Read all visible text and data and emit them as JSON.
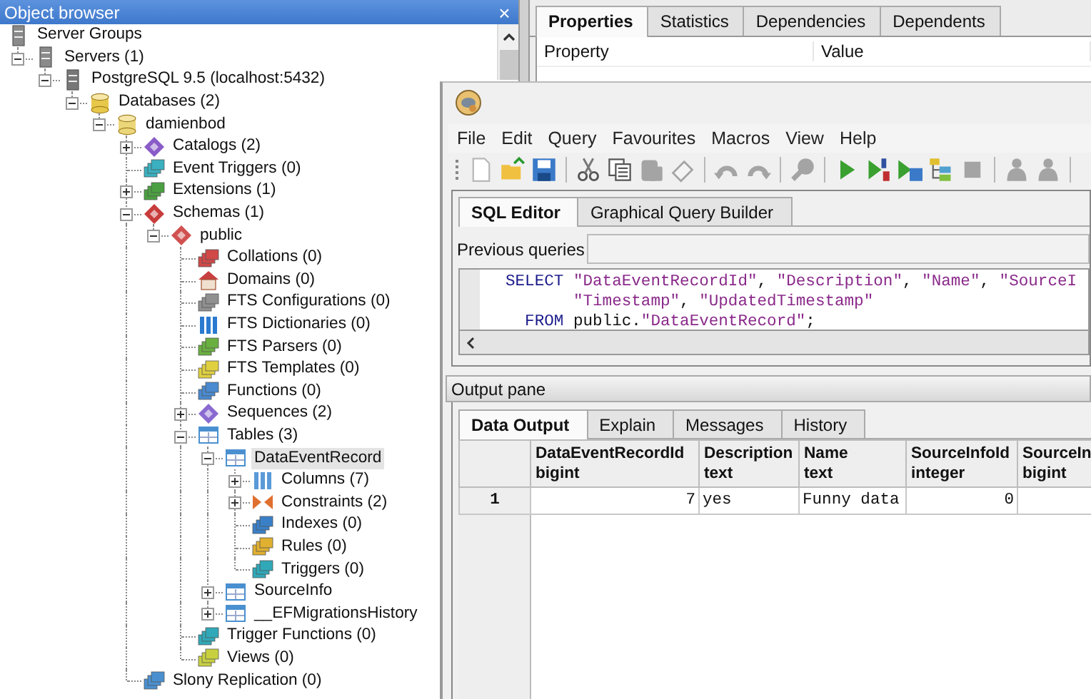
{
  "object_browser": {
    "title": "Object browser",
    "close": "×",
    "tree": [
      {
        "label": "Server Groups",
        "kind": "server_groups",
        "selected": false,
        "children": [
          {
            "label": "Servers (1)",
            "kind": "servers",
            "expanded": true,
            "selected": false,
            "children": [
              {
                "label": "PostgreSQL 9.5 (localhost:5432)",
                "kind": "server",
                "expanded": true,
                "selected": false,
                "children": [
                  {
                    "label": "Databases (2)",
                    "kind": "databases",
                    "expanded": true,
                    "selected": false,
                    "children": [
                      {
                        "label": "damienbod",
                        "kind": "database",
                        "expanded": true,
                        "selected": false,
                        "children": [
                          {
                            "label": "Catalogs (2)",
                            "kind": "catalogs",
                            "expanded": false,
                            "selected": false
                          },
                          {
                            "label": "Event Triggers (0)",
                            "kind": "event_triggers",
                            "selected": false
                          },
                          {
                            "label": "Extensions (1)",
                            "kind": "extensions",
                            "expanded": false,
                            "selected": false
                          },
                          {
                            "label": "Schemas (1)",
                            "kind": "schemas",
                            "expanded": true,
                            "selected": false,
                            "children": [
                              {
                                "label": "public",
                                "kind": "schema",
                                "expanded": true,
                                "selected": false,
                                "children": [
                                  {
                                    "label": "Collations (0)",
                                    "kind": "collations",
                                    "selected": false
                                  },
                                  {
                                    "label": "Domains (0)",
                                    "kind": "domains",
                                    "selected": false
                                  },
                                  {
                                    "label": "FTS Configurations (0)",
                                    "kind": "fts_configurations",
                                    "selected": false
                                  },
                                  {
                                    "label": "FTS Dictionaries (0)",
                                    "kind": "fts_dictionaries",
                                    "selected": false
                                  },
                                  {
                                    "label": "FTS Parsers (0)",
                                    "kind": "fts_parsers",
                                    "selected": false
                                  },
                                  {
                                    "label": "FTS Templates (0)",
                                    "kind": "fts_templates",
                                    "selected": false
                                  },
                                  {
                                    "label": "Functions (0)",
                                    "kind": "functions",
                                    "selected": false
                                  },
                                  {
                                    "label": "Sequences (2)",
                                    "kind": "sequences",
                                    "expanded": false,
                                    "selected": false
                                  },
                                  {
                                    "label": "Tables (3)",
                                    "kind": "tables",
                                    "expanded": true,
                                    "selected": false,
                                    "children": [
                                      {
                                        "label": "DataEventRecord",
                                        "kind": "table",
                                        "expanded": true,
                                        "selected": true,
                                        "children": [
                                          {
                                            "label": "Columns (7)",
                                            "kind": "columns",
                                            "expanded": false,
                                            "selected": false
                                          },
                                          {
                                            "label": "Constraints (2)",
                                            "kind": "constraints",
                                            "expanded": false,
                                            "selected": false
                                          },
                                          {
                                            "label": "Indexes (0)",
                                            "kind": "indexes",
                                            "selected": false
                                          },
                                          {
                                            "label": "Rules (0)",
                                            "kind": "rules",
                                            "selected": false
                                          },
                                          {
                                            "label": "Triggers (0)",
                                            "kind": "triggers",
                                            "selected": false
                                          }
                                        ]
                                      },
                                      {
                                        "label": "SourceInfo",
                                        "kind": "table",
                                        "expanded": false,
                                        "selected": false
                                      },
                                      {
                                        "label": "__EFMigrationsHistory",
                                        "kind": "table",
                                        "expanded": false,
                                        "selected": false
                                      }
                                    ]
                                  },
                                  {
                                    "label": "Trigger Functions (0)",
                                    "kind": "trigger_functions",
                                    "selected": false
                                  },
                                  {
                                    "label": "Views (0)",
                                    "kind": "views",
                                    "selected": false
                                  }
                                ]
                              }
                            ]
                          },
                          {
                            "label": "Slony Replication (0)",
                            "kind": "replication",
                            "selected": false
                          }
                        ]
                      }
                    ]
                  }
                ]
              }
            ]
          }
        ]
      }
    ]
  },
  "properties": {
    "tabs": [
      {
        "label": "Properties",
        "selected": true
      },
      {
        "label": "Statistics",
        "selected": false
      },
      {
        "label": "Dependencies",
        "selected": false
      },
      {
        "label": "Dependents",
        "selected": false
      }
    ],
    "columns": [
      "Property",
      "Value"
    ]
  },
  "query_tool": {
    "menu": [
      "File",
      "Edit",
      "Query",
      "Favourites",
      "Macros",
      "View",
      "Help"
    ],
    "toolbar": [
      {
        "kind": "new",
        "disabled": false
      },
      {
        "kind": "open",
        "disabled": false
      },
      {
        "kind": "save",
        "disabled": false
      },
      {
        "kind": "separator"
      },
      {
        "kind": "cut",
        "disabled": false
      },
      {
        "kind": "copy",
        "disabled": false
      },
      {
        "kind": "paste",
        "disabled": true
      },
      {
        "kind": "clear",
        "disabled": true
      },
      {
        "kind": "separator"
      },
      {
        "kind": "undo",
        "disabled": true
      },
      {
        "kind": "redo",
        "disabled": true
      },
      {
        "kind": "separator"
      },
      {
        "kind": "find",
        "disabled": true
      },
      {
        "kind": "separator"
      },
      {
        "kind": "execute",
        "disabled": false
      },
      {
        "kind": "execute_script",
        "disabled": false
      },
      {
        "kind": "execute_file",
        "disabled": false
      },
      {
        "kind": "explain",
        "disabled": false
      },
      {
        "kind": "cancel",
        "disabled": true
      },
      {
        "kind": "separator"
      },
      {
        "kind": "figure",
        "disabled": true
      },
      {
        "kind": "figure",
        "disabled": true
      },
      {
        "kind": "separator"
      }
    ],
    "editor_tabs": [
      {
        "label": "SQL Editor",
        "selected": true
      },
      {
        "label": "Graphical Query Builder",
        "selected": false
      }
    ],
    "previous_queries_label": "Previous queries",
    "sql_lines": [
      [
        {
          "kind": "keyword",
          "text": "SELECT"
        },
        {
          "kind": "string",
          "text": " \"DataEventRecordId\""
        },
        {
          "kind": "plain",
          "text": ", "
        },
        {
          "kind": "string",
          "text": "\"Description\""
        },
        {
          "kind": "plain",
          "text": ", "
        },
        {
          "kind": "string",
          "text": "\"Name\""
        },
        {
          "kind": "plain",
          "text": ", "
        },
        {
          "kind": "string",
          "text": "\"SourceI"
        }
      ],
      [
        {
          "kind": "string",
          "text": "       \"Timestamp\""
        },
        {
          "kind": "plain",
          "text": ", "
        },
        {
          "kind": "string",
          "text": "\"UpdatedTimestamp\""
        }
      ],
      [
        {
          "kind": "keyword",
          "text": "  FROM"
        },
        {
          "kind": "plain",
          "text": " public."
        },
        {
          "kind": "string",
          "text": "\"DataEventRecord\""
        },
        {
          "kind": "plain",
          "text": ";"
        }
      ]
    ],
    "output_label": "Output pane",
    "output_tabs": [
      {
        "label": "Data Output",
        "selected": true
      },
      {
        "label": "Explain",
        "selected": false
      },
      {
        "label": "Messages",
        "selected": false
      },
      {
        "label": "History",
        "selected": false
      }
    ],
    "grid": {
      "columns": [
        {
          "name": "DataEventRecordId",
          "type": "bigint",
          "kind": "numeric"
        },
        {
          "name": "Description",
          "type": "text",
          "kind": "text"
        },
        {
          "name": "Name",
          "type": "text",
          "kind": "text"
        },
        {
          "name": "SourceInfoId",
          "type": "integer",
          "kind": "numeric"
        },
        {
          "name": "SourceIn",
          "type": "bigint"
        }
      ],
      "rows": [
        {
          "number": "1",
          "cells": [
            "7",
            "yes",
            "Funny data",
            "0"
          ]
        }
      ]
    }
  }
}
